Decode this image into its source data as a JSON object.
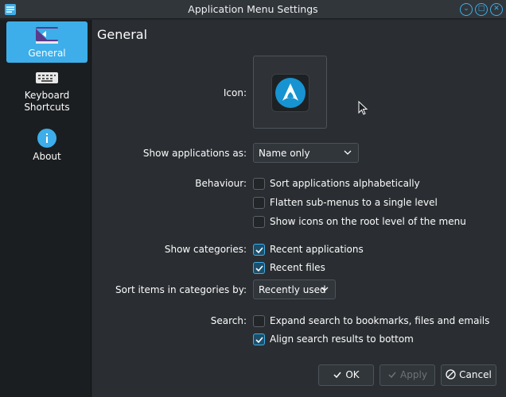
{
  "window": {
    "title": "Application Menu Settings"
  },
  "sidebar": {
    "items": [
      {
        "label": "General",
        "icon": "general-settings-icon",
        "active": true
      },
      {
        "label": "Keyboard Shortcuts",
        "line1": "Keyboard",
        "line2": "Shortcuts",
        "icon": "keyboard-icon",
        "active": false
      },
      {
        "label": "About",
        "icon": "info-icon",
        "active": false
      }
    ]
  },
  "page": {
    "title": "General",
    "icon_label": "Icon:",
    "icon_name": "arch-logo-icon",
    "show_as_label": "Show applications as:",
    "show_as_value": "Name only",
    "behaviour_label": "Behaviour:",
    "behaviour_options": [
      {
        "label": "Sort applications alphabetically",
        "checked": false
      },
      {
        "label": "Flatten sub-menus to a single level",
        "checked": false
      },
      {
        "label": "Show icons on the root level of the menu",
        "checked": false
      }
    ],
    "categories_label": "Show categories:",
    "categories_options": [
      {
        "label": "Recent applications",
        "checked": true
      },
      {
        "label": "Recent files",
        "checked": true
      }
    ],
    "sort_label": "Sort items in categories by:",
    "sort_value": "Recently used",
    "search_label": "Search:",
    "search_options": [
      {
        "label": "Expand search to bookmarks, files and emails",
        "checked": false
      },
      {
        "label": "Align search results to bottom",
        "checked": true
      }
    ]
  },
  "buttons": {
    "ok": "OK",
    "apply": "Apply",
    "cancel": "Cancel"
  },
  "colors": {
    "accent": "#3daee9",
    "background": "#2a2e32",
    "sidebar": "#1b1e20"
  }
}
